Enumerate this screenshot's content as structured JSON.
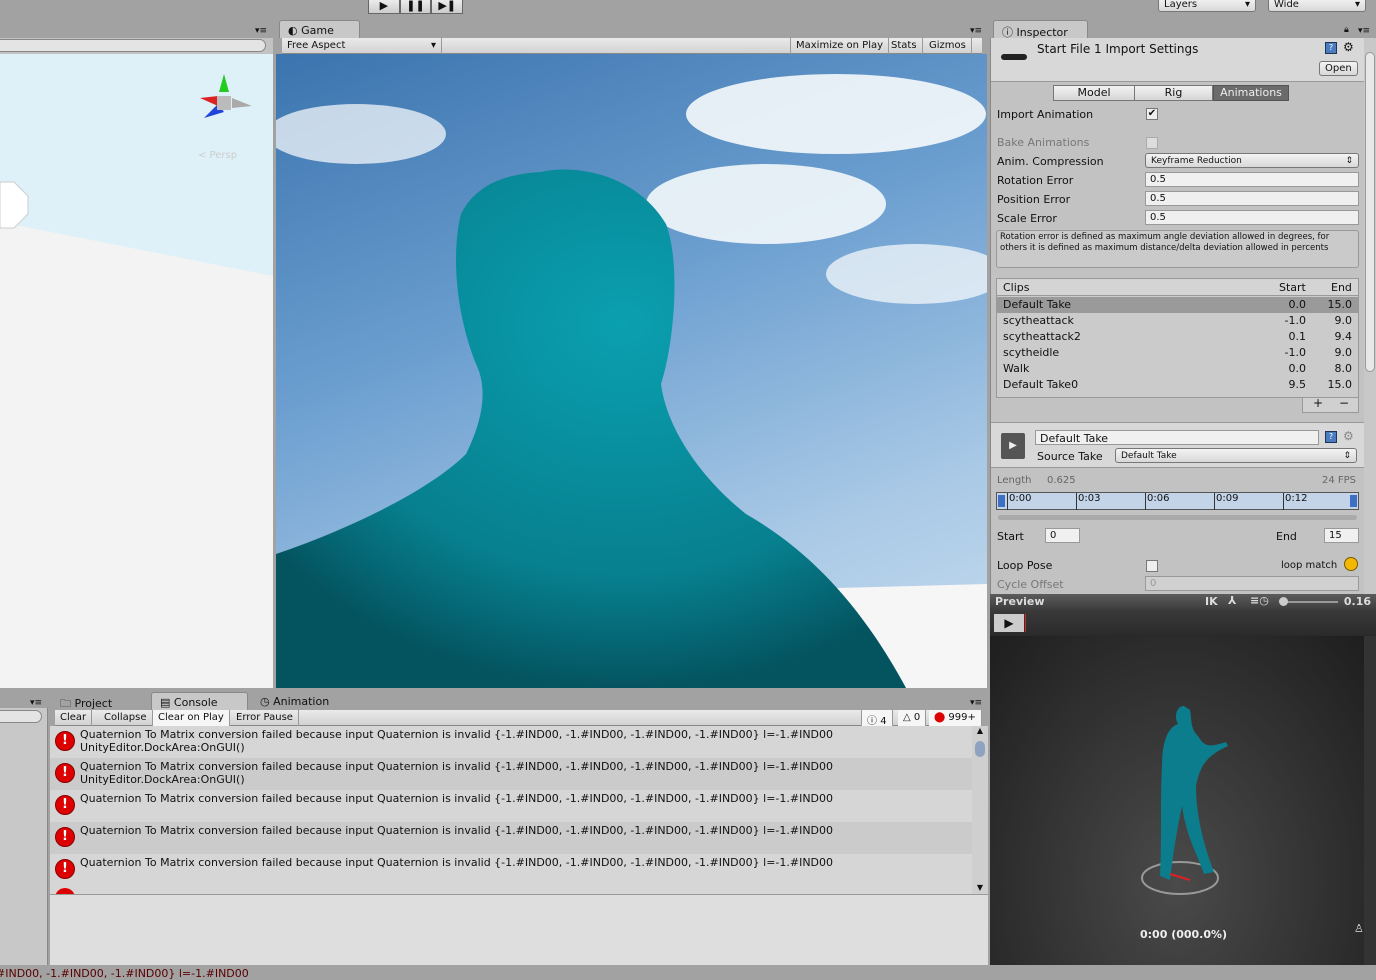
{
  "toolbar": {
    "layers": "Layers",
    "layout": "Wide"
  },
  "scene": {
    "persp": "< Persp"
  },
  "game": {
    "tab": "Game",
    "aspect": "Free Aspect",
    "maximize": "Maximize on Play",
    "stats": "Stats",
    "gizmos": "Gizmos"
  },
  "inspector": {
    "tab": "Inspector",
    "title": "Start File 1 Import Settings",
    "open": "Open",
    "tabs": [
      "Model",
      "Rig",
      "Animations"
    ],
    "import_animation": "Import Animation",
    "bake_animations": "Bake Animations",
    "anim_compression": "Anim. Compression",
    "anim_compression_value": "Keyframe Reduction",
    "rotation_error": "Rotation Error",
    "rotation_error_value": "0.5",
    "position_error": "Position Error",
    "position_error_value": "0.5",
    "scale_error": "Scale Error",
    "scale_error_value": "0.5",
    "help": "Rotation error is defined as maximum angle deviation allowed in degrees, for others it is defined as maximum distance/delta deviation allowed in percents",
    "clips_header": {
      "name": "Clips",
      "start": "Start",
      "end": "End"
    },
    "clips": [
      {
        "name": "Default Take",
        "start": "0.0",
        "end": "15.0"
      },
      {
        "name": "scytheattack",
        "start": "-1.0",
        "end": "9.0"
      },
      {
        "name": "scytheattack2",
        "start": "0.1",
        "end": "9.4"
      },
      {
        "name": "scytheidle",
        "start": "-1.0",
        "end": "9.0"
      },
      {
        "name": "Walk",
        "start": "0.0",
        "end": "8.0"
      },
      {
        "name": "Default Take0",
        "start": "9.5",
        "end": "15.0"
      }
    ],
    "clip_name": "Default Take",
    "source_take_label": "Source Take",
    "source_take": "Default Take",
    "length_label": "Length",
    "length": "0.625",
    "fps": "24 FPS",
    "timeline": [
      "0:00",
      "0:03",
      "0:06",
      "0:09",
      "0:12"
    ],
    "start_label": "Start",
    "start": "0",
    "end_label": "End",
    "end": "15",
    "loop_pose": "Loop Pose",
    "loop_match": "loop match",
    "loop_match_color": "#f5b800",
    "cycle_offset": "Cycle Offset",
    "cycle_offset_value": "0"
  },
  "preview": {
    "label": "Preview",
    "ik": "IK",
    "speed": "0.16",
    "speed_fraction": 0.05,
    "time": "0:00 (000.0%)"
  },
  "console": {
    "tabs": [
      "Project",
      "Console",
      "Animation"
    ],
    "buttons": [
      "Clear",
      "Collapse",
      "Clear on Play",
      "Error Pause"
    ],
    "info_count": "4",
    "warn_count": "0",
    "error_count": "999+",
    "logs": [
      {
        "line1": "Quaternion To Matrix conversion failed because input Quaternion is invalid {-1.#IND00, -1.#IND00, -1.#IND00, -1.#IND00} l=-1.#IND00",
        "line2": "UnityEditor.DockArea:OnGUI()"
      },
      {
        "line1": "Quaternion To Matrix conversion failed because input Quaternion is invalid {-1.#IND00, -1.#IND00, -1.#IND00, -1.#IND00} l=-1.#IND00",
        "line2": "UnityEditor.DockArea:OnGUI()"
      },
      {
        "line1": "Quaternion To Matrix conversion failed because input Quaternion is invalid {-1.#IND00, -1.#IND00, -1.#IND00, -1.#IND00} l=-1.#IND00",
        "line2": ""
      },
      {
        "line1": "Quaternion To Matrix conversion failed because input Quaternion is invalid {-1.#IND00, -1.#IND00, -1.#IND00, -1.#IND00} l=-1.#IND00",
        "line2": ""
      },
      {
        "line1": "Quaternion To Matrix conversion failed because input Quaternion is invalid {-1.#IND00, -1.#IND00, -1.#IND00, -1.#IND00} l=-1.#IND00",
        "line2": ""
      }
    ]
  },
  "status": "#IND00, -1.#IND00, -1.#IND00} l=-1.#IND00"
}
